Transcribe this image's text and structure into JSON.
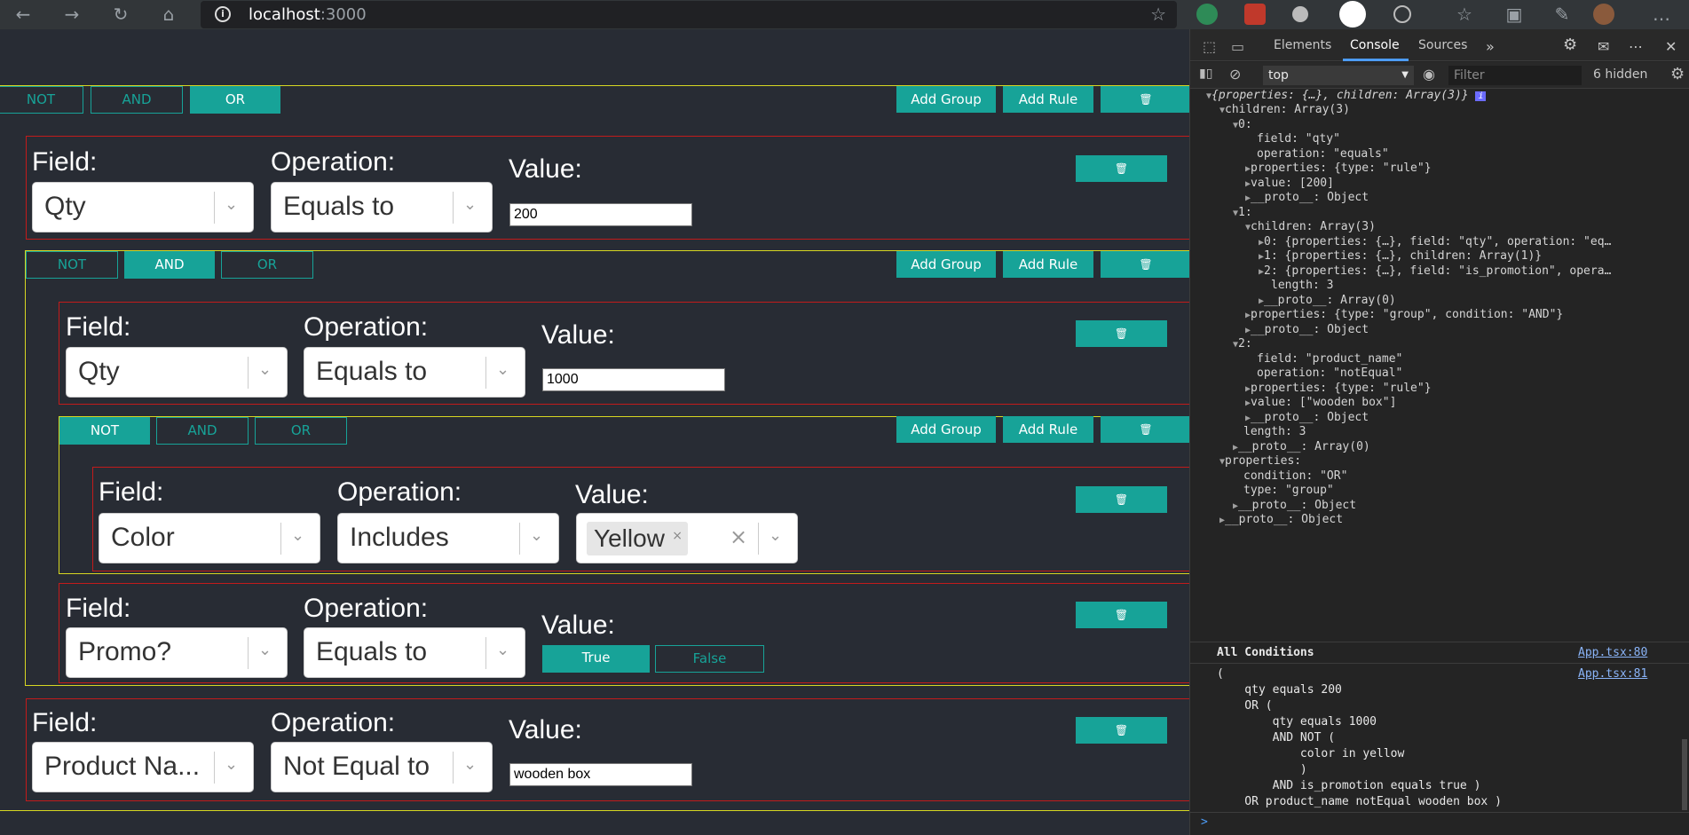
{
  "browser": {
    "url_host": "localhost",
    "url_port": ":3000"
  },
  "app": {
    "labels": {
      "field": "Field:",
      "operation": "Operation:",
      "value": "Value:"
    },
    "toggle": {
      "not": "NOT",
      "and": "AND",
      "or": "OR"
    },
    "actions": {
      "add_group": "Add Group",
      "add_rule": "Add Rule",
      "delete": "🗑"
    },
    "rule1": {
      "field": "Qty",
      "operation": "Equals to",
      "value": "200"
    },
    "rule2": {
      "field": "Qty",
      "operation": "Equals to",
      "value": "1000"
    },
    "rule3": {
      "field": "Color",
      "operation": "Includes",
      "tag": "Yellow"
    },
    "rule4": {
      "field": "Promo?",
      "operation": "Equals to",
      "true_label": "True",
      "false_label": "False"
    },
    "rule5": {
      "field": "Product Na...",
      "operation": "Not Equal to",
      "value": "wooden box"
    }
  },
  "devtools": {
    "tabs": [
      "Elements",
      "Console",
      "Sources"
    ],
    "context": "top",
    "filter_placeholder": "Filter",
    "hidden_count": "6 hidden",
    "tree": [
      "{properties: {…}, children: Array(3)}",
      "children: Array(3)",
      "0:",
      "field: \"qty\"",
      "operation: \"equals\"",
      "properties: {type: \"rule\"}",
      "value: [200]",
      "__proto__: Object",
      "1:",
      "children: Array(3)",
      "0: {properties: {…}, field: \"qty\", operation: \"eq…",
      "1: {properties: {…}, children: Array(1)}",
      "2: {properties: {…}, field: \"is_promotion\", opera…",
      "length: 3",
      "__proto__: Array(0)",
      "properties: {type: \"group\", condition: \"AND\"}",
      "__proto__: Object",
      "2:",
      "field: \"product_name\"",
      "operation: \"notEqual\"",
      "properties: {type: \"rule\"}",
      "value: [\"wooden box\"]",
      "__proto__: Object",
      "length: 3",
      "__proto__: Array(0)",
      "properties:",
      "condition: \"OR\"",
      "type: \"group\"",
      "__proto__: Object",
      "__proto__: Object"
    ],
    "log_title": "All Conditions",
    "log_src1": "App.tsx:80",
    "log_src2": "App.tsx:81",
    "log_lines": [
      "(",
      "    qty equals 200",
      "    OR (",
      "        qty equals 1000",
      "        AND NOT (",
      "            color in yellow",
      "            )",
      "        AND is_promotion equals true )",
      "    OR product_name notEqual wooden box )"
    ],
    "prompt": ">"
  }
}
